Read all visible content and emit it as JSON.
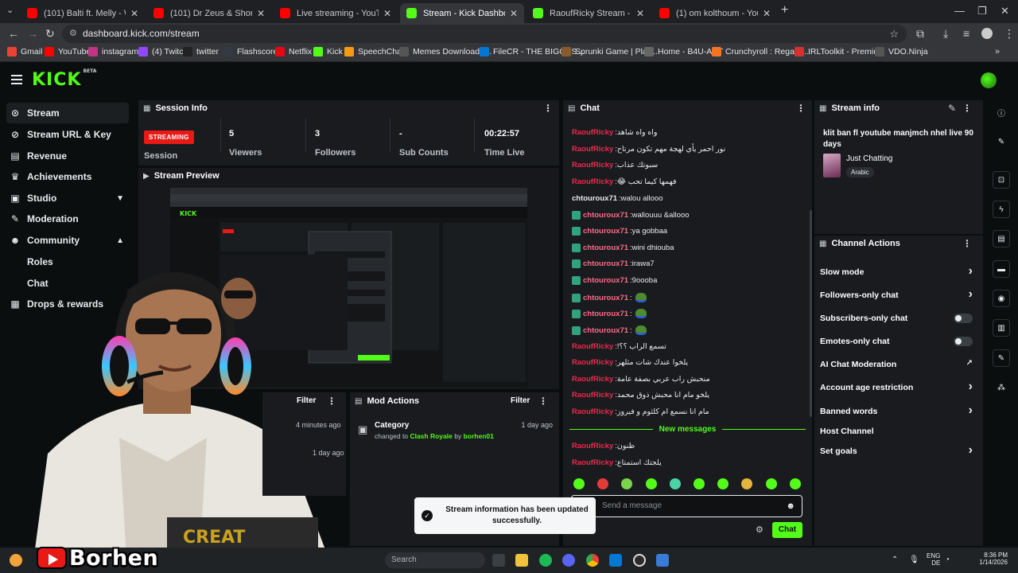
{
  "browser": {
    "tabs": [
      {
        "title": "(101) Balti ft. Melly - Wino El Ha",
        "color": "#ff0000",
        "active": false
      },
      {
        "title": "(101) Dr Zeus & Shortie | Jugni",
        "color": "#ff0000",
        "active": false
      },
      {
        "title": "Live streaming - YouTube Studio",
        "color": "#ff0000",
        "active": false
      },
      {
        "title": "Stream - Kick Dashboard",
        "color": "#53fc18",
        "active": true
      },
      {
        "title": "RaoufRicky Stream - Watch Live",
        "color": "#53fc18",
        "active": false
      },
      {
        "title": "(1) om kolthoum - YouTube",
        "color": "#ff0000",
        "active": false
      }
    ],
    "url": "dashboard.kick.com/stream",
    "bookmarks": [
      {
        "label": "Gmail",
        "color": "#ea4335"
      },
      {
        "label": "YouTube",
        "color": "#ff0000"
      },
      {
        "label": "instagram",
        "color": "#c13584"
      },
      {
        "label": "(4) Twitch",
        "color": "#9146ff"
      },
      {
        "label": "twitter",
        "color": "#222222"
      },
      {
        "label": "Flashscore",
        "color": "#333a44"
      },
      {
        "label": "Netflix",
        "color": "#e50914"
      },
      {
        "label": "Kick",
        "color": "#53fc18"
      },
      {
        "label": "SpeechChat",
        "color": "#f39c12"
      },
      {
        "label": "Memes Download -...",
        "color": "#555555"
      },
      {
        "label": "FileCR - THE BIGGES...",
        "color": "#0078d4"
      },
      {
        "label": "Sprunki Game | Play...",
        "color": "#8b5a2b"
      },
      {
        "label": "Home - B4U-ACT",
        "color": "#666666"
      },
      {
        "label": "Crunchyroll : Regard...",
        "color": "#f47521"
      },
      {
        "label": "IRLToolkit - Premiu...",
        "color": "#d63031"
      },
      {
        "label": "VDO.Ninja",
        "color": "#555555"
      }
    ]
  },
  "brand": {
    "logo": "KICK",
    "logo_sup": "BETA",
    "accent": "#53fc18"
  },
  "sidebar": {
    "items": [
      {
        "label": "Stream",
        "icon": "broadcast-icon",
        "glyph": "((•))"
      },
      {
        "label": "Stream URL & Key",
        "icon": "link-icon",
        "glyph": "🔗"
      },
      {
        "label": "Revenue",
        "icon": "dollar-icon",
        "glyph": "$"
      },
      {
        "label": "Achievements",
        "icon": "trophy-icon",
        "glyph": "🏆"
      },
      {
        "label": "Studio",
        "icon": "studio-icon",
        "glyph": "▣"
      },
      {
        "label": "Moderation",
        "icon": "wrench-icon",
        "glyph": "🔧"
      },
      {
        "label": "Community",
        "icon": "users-icon",
        "glyph": "👥"
      },
      {
        "label": "Drops & rewards",
        "icon": "gift-icon",
        "glyph": "🎁"
      }
    ],
    "sub": [
      "Roles",
      "Chat"
    ]
  },
  "session": {
    "title": "Session Info",
    "status": "STREAMING",
    "status_label": "Session",
    "viewers": "5",
    "viewers_label": "Viewers",
    "followers": "3",
    "followers_label": "Followers",
    "subs": "-",
    "subs_label": "Sub Counts",
    "time": "00:22:57",
    "time_label": "Time Live"
  },
  "preview": {
    "title": "Stream Preview"
  },
  "activity": {
    "filter": "Filter",
    "times": [
      "4 minutes ago",
      "1 day ago"
    ]
  },
  "mod": {
    "title": "Mod Actions",
    "filter": "Filter",
    "entry": {
      "title": "Category",
      "prefix": "changed to",
      "value": "Clash Royale",
      "by": "by",
      "user": "borhen01",
      "time": "1 day ago"
    }
  },
  "chat": {
    "title": "Chat",
    "messages": [
      {
        "user": "RaoufRicky",
        "text": "واه واه شاهد",
        "style": "green",
        "badge": false,
        "pepe": false
      },
      {
        "user": "RaoufRicky",
        "text": "نور احمر يأي لهجة مهم تكون مرتاح",
        "style": "green",
        "badge": false,
        "pepe": false
      },
      {
        "user": "RaoufRicky",
        "text": "سبوتك عذاب",
        "style": "green",
        "badge": false,
        "pepe": false
      },
      {
        "user": "RaoufRicky",
        "text": "فهمها كيما تحب 😂",
        "style": "green",
        "badge": false,
        "pepe": false
      },
      {
        "user": "chtouroux71",
        "text": "walou allooo",
        "style": "plain",
        "badge": false,
        "pepe": false
      },
      {
        "user": "chtouroux71",
        "text": "wallouuu &allooo",
        "style": "pink",
        "badge": true,
        "pepe": false
      },
      {
        "user": "chtouroux71",
        "text": "ya gobbaa",
        "style": "pink",
        "badge": true,
        "pepe": false
      },
      {
        "user": "chtouroux71",
        "text": "wini dhiouba",
        "style": "pink",
        "badge": true,
        "pepe": false
      },
      {
        "user": "chtouroux71",
        "text": "irawa7",
        "style": "pink",
        "badge": true,
        "pepe": false
      },
      {
        "user": "chtouroux71",
        "text": "9oooba",
        "style": "pink",
        "badge": true,
        "pepe": false
      },
      {
        "user": "chtouroux71",
        "text": "",
        "style": "pink",
        "badge": true,
        "pepe": true
      },
      {
        "user": "chtouroux71",
        "text": "",
        "style": "pink",
        "badge": true,
        "pepe": true
      },
      {
        "user": "chtouroux71",
        "text": "",
        "style": "pink",
        "badge": true,
        "pepe": true
      },
      {
        "user": "RaoufRicky",
        "text": "تسمع الراب ؟؟!",
        "style": "green",
        "badge": false,
        "pepe": false
      },
      {
        "user": "RaoufRicky",
        "text": "يلخوا عندك شات مثلهر",
        "style": "green",
        "badge": false,
        "pepe": false
      },
      {
        "user": "RaoufRicky",
        "text": "منحبش راب عربي بصفة عامة",
        "style": "green",
        "badge": false,
        "pepe": false
      },
      {
        "user": "RaoufRicky",
        "text": "يلخو مام انا محبش ذوق محمد",
        "style": "green",
        "badge": false,
        "pepe": false
      },
      {
        "user": "RaoufRicky",
        "text": "مام انا نسمع ام كلثوم و فيروز",
        "style": "green",
        "badge": false,
        "pepe": false
      }
    ],
    "new_label": "New messages",
    "new_messages": [
      {
        "user": "RaoufRicky",
        "text": "ظنون"
      },
      {
        "user": "RaoufRicky",
        "text": "يلجتك استمتاع"
      }
    ],
    "emote_colors": [
      "#53fc18",
      "#e53a3a",
      "#7bd34b",
      "#53fc18",
      "#4bd3a7",
      "#53fc18",
      "#53fc18",
      "#e5b43a",
      "#53fc18",
      "#53fc18"
    ],
    "placeholder": "Send a message",
    "send": "Chat"
  },
  "stream_info": {
    "title": "Stream info",
    "stream_title": "klit ban fl youtube manjmch nhel live 90 days",
    "category": "Just Chatting",
    "language": "Arabic"
  },
  "channel_actions": {
    "title": "Channel Actions",
    "rows": [
      {
        "label": "Slow mode",
        "kind": "arrow"
      },
      {
        "label": "Followers-only chat",
        "kind": "arrow"
      },
      {
        "label": "Subscribers-only chat",
        "kind": "toggle"
      },
      {
        "label": "Emotes-only chat",
        "kind": "toggle"
      },
      {
        "label": "AI Chat Moderation",
        "kind": "external"
      },
      {
        "label": "Account age restriction",
        "kind": "arrow"
      },
      {
        "label": "Banned words",
        "kind": "arrow"
      },
      {
        "label": "Host Channel",
        "kind": "none"
      },
      {
        "label": "Set goals",
        "kind": "arrow"
      }
    ]
  },
  "toast": {
    "text": "Stream information has been updated successfully."
  },
  "taskbar": {
    "search": "Search",
    "lang1": "ENG",
    "lang2": "DE",
    "time": "8:36 PM",
    "date": "1/14/2026"
  },
  "overlay": {
    "name": "Borhen"
  }
}
